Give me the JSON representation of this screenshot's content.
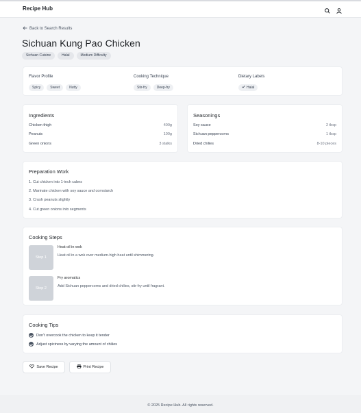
{
  "header": {
    "brand": "Recipe Hub",
    "icons": [
      "search-icon",
      "user-icon"
    ]
  },
  "nav": {
    "back_label": "Back to Search Results"
  },
  "recipe": {
    "title": "Sichuan Kung Pao Chicken",
    "tags": [
      "Sichuan Cuisine",
      "Halal",
      "Medium Difficulty"
    ]
  },
  "attributes": {
    "flavor": {
      "label": "Flavor Profile",
      "values": [
        "Spicy",
        "Sweet",
        "Nutty"
      ]
    },
    "technique": {
      "label": "Cooking Technique",
      "values": [
        "Stir-fry",
        "Deep-fry"
      ]
    },
    "dietary": {
      "label": "Dietary Labels",
      "values": [
        "Halal"
      ]
    }
  },
  "ingredients": {
    "title": "Ingredients",
    "items": [
      {
        "name": "Chicken thigh",
        "qty": "400g"
      },
      {
        "name": "Peanuts",
        "qty": "100g"
      },
      {
        "name": "Green onions",
        "qty": "3 stalks"
      }
    ]
  },
  "seasonings": {
    "title": "Seasonings",
    "items": [
      {
        "name": "Soy sauce",
        "qty": "2 tbsp"
      },
      {
        "name": "Sichuan peppercorns",
        "qty": "1 tbsp"
      },
      {
        "name": "Dried chilies",
        "qty": "8-10 pieces"
      }
    ]
  },
  "preparation": {
    "title": "Preparation Work",
    "steps": [
      "1. Cut chicken into 1-inch cubes",
      "2. Marinate chicken with soy sauce and cornstarch",
      "3. Crush peanuts slightly",
      "4. Cut green onions into segments"
    ]
  },
  "cooking": {
    "title": "Cooking Steps",
    "steps": [
      {
        "badge": "Step 1",
        "title": "Heat oil in wok",
        "desc": "Heat oil in a wok over medium-high heat until shimmering."
      },
      {
        "badge": "Step 2",
        "title": "Fry aromatics",
        "desc": "Add Sichuan peppercorns and dried chilies, stir-fry until fragrant."
      }
    ]
  },
  "tips": {
    "title": "Cooking Tips",
    "items": [
      "Don't overcook the chicken to keep it tender",
      "Adjust spiciness by varying the amount of chilies"
    ]
  },
  "actions": {
    "save_label": "Save Recipe",
    "print_label": "Print Recipe"
  },
  "footer": {
    "text": "© 2025 Recipe Hub. All rights reserved."
  }
}
